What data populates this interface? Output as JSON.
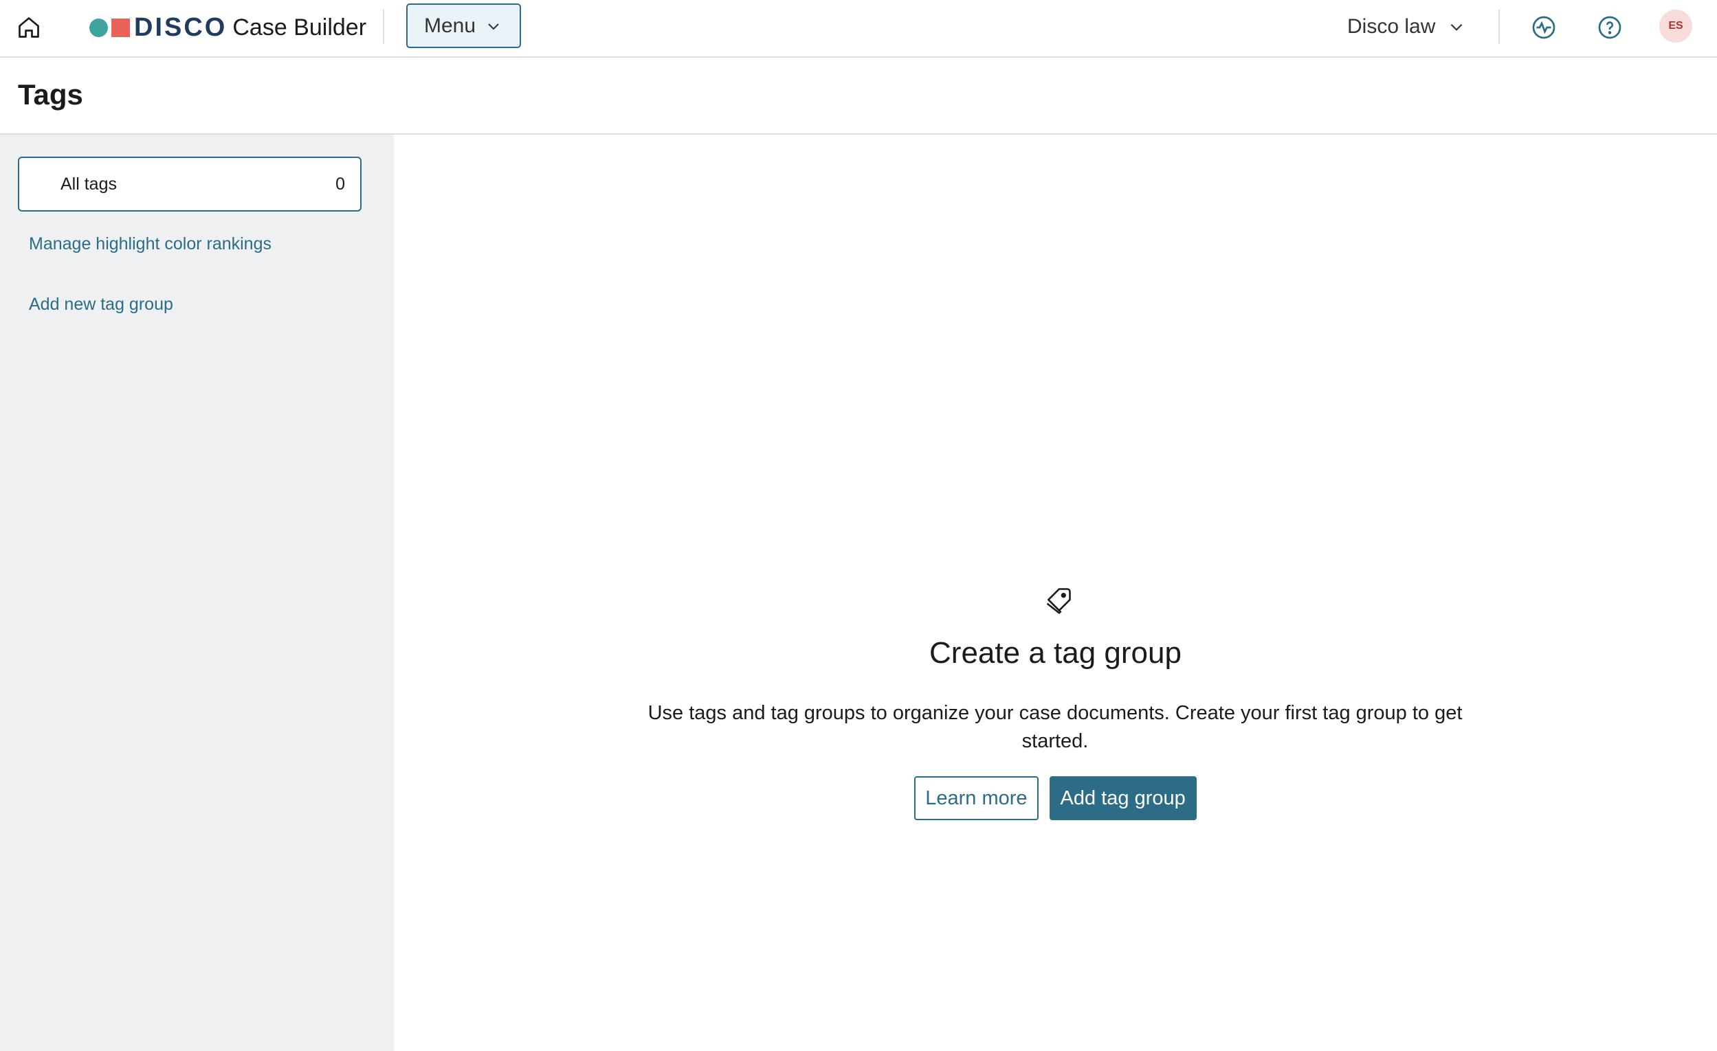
{
  "header": {
    "brand": "DISCO",
    "product": "Case Builder",
    "menu_label": "Menu",
    "org_label": "Disco law",
    "avatar_initials": "ES"
  },
  "page": {
    "title": "Tags"
  },
  "sidebar": {
    "all_tags_label": "All tags",
    "all_tags_count": "0",
    "links": [
      "Manage highlight color rankings",
      "Add new tag group"
    ]
  },
  "empty_state": {
    "title": "Create a tag group",
    "description": "Use tags and tag groups to organize your case documents. Create your first tag group to get started.",
    "learn_more_label": "Learn more",
    "add_label": "Add tag group"
  },
  "colors": {
    "accent": "#2c6c86",
    "logo_dot": "#3fa39e",
    "logo_square": "#e8625a",
    "brand_text": "#1f3c5f",
    "sidebar_bg": "#eef0f2"
  },
  "icons": [
    "home-icon",
    "chevron-down-icon",
    "activity-icon",
    "help-icon",
    "tag-icon"
  ]
}
